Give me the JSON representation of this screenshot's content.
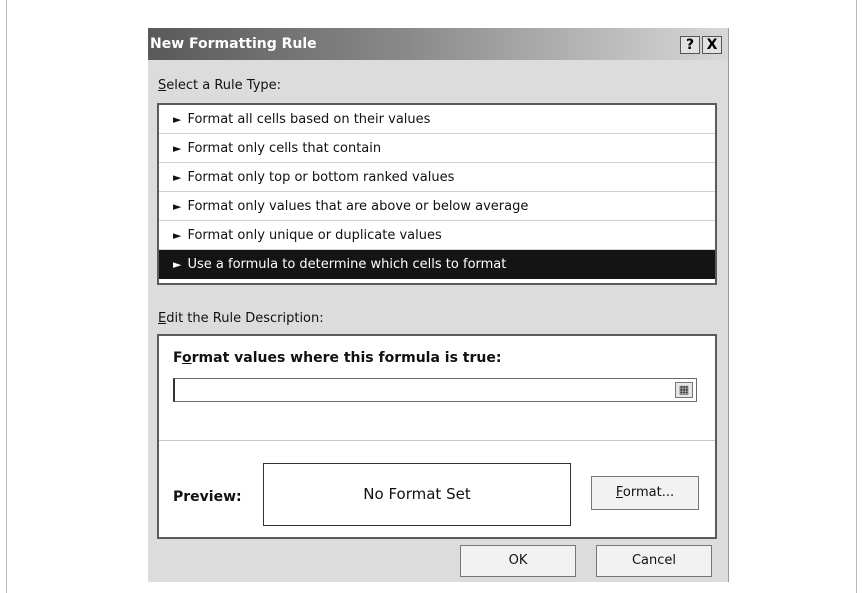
{
  "dialog": {
    "title": "New Formatting Rule",
    "help_button": "?",
    "close_button": "X"
  },
  "rule_type": {
    "label_prefix": "S",
    "label_rest": "elect a Rule Type:",
    "items": [
      {
        "label": "Format all cells based on their values",
        "selected": false
      },
      {
        "label": "Format only cells that contain",
        "selected": false
      },
      {
        "label": "Format only top or bottom ranked values",
        "selected": false
      },
      {
        "label": "Format only values that are above or below average",
        "selected": false
      },
      {
        "label": "Format only unique or duplicate values",
        "selected": false
      },
      {
        "label": "Use a formula to determine which cells to format",
        "selected": true
      }
    ],
    "arrow_glyph": "►"
  },
  "description": {
    "label_prefix": "E",
    "label_rest": "dit the Rule Description:",
    "heading_pre": "F",
    "heading_ul": "o",
    "heading_rest": "rmat values where this formula is true:",
    "formula_value": "",
    "preview_label": "Preview:",
    "preview_text": "No Format Set",
    "format_button_ul": "F",
    "format_button_rest": "ormat..."
  },
  "buttons": {
    "ok": "OK",
    "cancel": "Cancel"
  }
}
